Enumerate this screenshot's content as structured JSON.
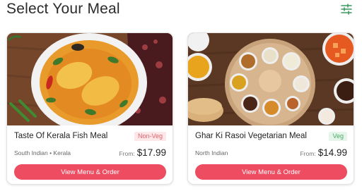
{
  "header": {
    "title": "Select Your Meal",
    "filter_icon": "sliders-filter-icon",
    "accent_color": "#3a9a5c"
  },
  "meals": [
    {
      "name": "Taste Of Kerala Fish Meal",
      "badge": "Non-Veg",
      "cuisine": "South Indian • Kerala",
      "price_prefix": "From:",
      "price": "$17.99",
      "button_label": "View Menu & Order"
    },
    {
      "name": "Ghar Ki Rasoi Vegetarian Meal",
      "badge": "Veg",
      "cuisine": "North Indian",
      "price_prefix": "From:",
      "price": "$14.99",
      "button_label": "View Menu & Order"
    }
  ],
  "colors": {
    "button": "#ee4c61",
    "nonveg_badge_text": "#e3616d",
    "veg_badge_text": "#4caa66"
  }
}
